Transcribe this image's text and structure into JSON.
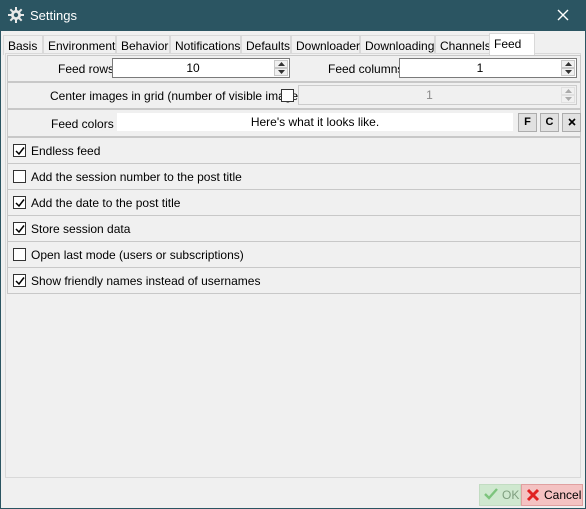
{
  "window": {
    "title": "Settings",
    "icon": "gear-icon"
  },
  "tabs": [
    {
      "label": "Basis"
    },
    {
      "label": "Environment"
    },
    {
      "label": "Behavior"
    },
    {
      "label": "Notifications"
    },
    {
      "label": "Defaults"
    },
    {
      "label": "Downloader"
    },
    {
      "label": "Downloading"
    },
    {
      "label": "Channels"
    },
    {
      "label": "Feed",
      "active": true
    }
  ],
  "feed": {
    "rows_label": "Feed rows",
    "rows_value": "10",
    "columns_label": "Feed columns",
    "columns_value": "1",
    "center_label": "Center images in grid (number of visible images)",
    "center_checked": false,
    "center_value": "1",
    "colors_label": "Feed colors",
    "colors_preview": "Here's what it looks like.",
    "color_buttons": [
      "F",
      "C"
    ],
    "color_clear_icon": "close-icon"
  },
  "options": [
    {
      "label": "Endless feed",
      "checked": true
    },
    {
      "label": "Add the session number to the post title",
      "checked": false
    },
    {
      "label": "Add the date to the post title",
      "checked": true
    },
    {
      "label": "Store session data",
      "checked": true
    },
    {
      "label": "Open last mode (users or subscriptions)",
      "checked": false
    },
    {
      "label": "Show friendly names instead of usernames",
      "checked": true
    }
  ],
  "footer": {
    "ok_label": "OK",
    "ok_icon": "checkmark-icon",
    "cancel_label": "Cancel",
    "cancel_icon": "x-icon"
  },
  "colors": {
    "titlebar": "#2b5562",
    "ok_bg": "#cfe8cf",
    "cancel_bg": "#f4c2c2",
    "cancel_icon": "#e02020",
    "ok_icon": "#7dc47d"
  }
}
